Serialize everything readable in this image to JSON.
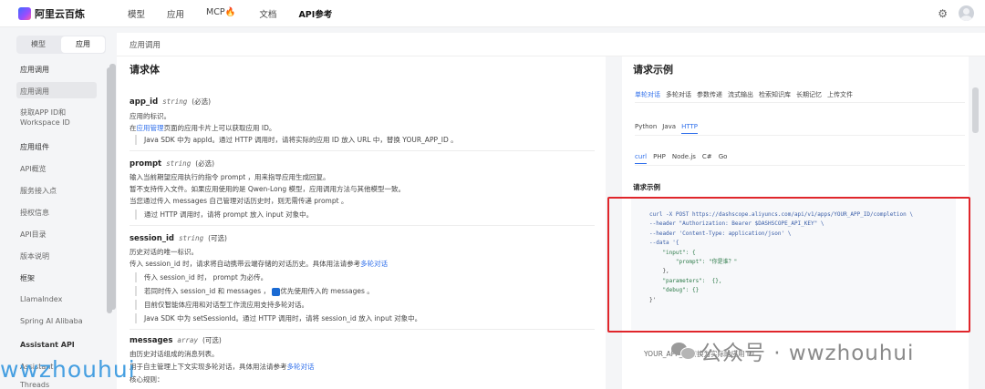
{
  "brand": {
    "name": "阿里云百炼"
  },
  "topnav": {
    "items": [
      "模型",
      "应用",
      "MCP🔥",
      "文档",
      "API参考"
    ]
  },
  "sidebar": {
    "segments": [
      "模型",
      "应用"
    ],
    "section_top": "应用调用",
    "items": [
      "应用调用",
      "获取APP ID和",
      "Workspace ID",
      "应用组件",
      "API概览",
      "服务接入点",
      "授权信息",
      "API目录",
      "版本说明",
      "框架",
      "LlamaIndex",
      "Spring AI Alibaba",
      "Assistant API",
      "Assistant",
      "Threads"
    ]
  },
  "breadcrumb": "应用调用",
  "doc": {
    "title": "请求体",
    "app_id": {
      "name": "app_id",
      "type": "string",
      "req": "(必选)",
      "desc1": "应用的标识。",
      "desc2_pre": "在",
      "desc2_link": "应用管理",
      "desc2_post": "页面的应用卡片上可以获取应用 ID。",
      "note": "Java SDK 中为 appId。通过 HTTP 调用时，请将实际的应用 ID 放入 URL 中，替换 YOUR_APP_ID 。"
    },
    "prompt": {
      "name": "prompt",
      "type": "string",
      "req": "(必选)",
      "desc1": "输入当前期望应用执行的指令 prompt ，用来指导应用生成回复。",
      "desc2": "暂不支持传入文件。如果应用使用的是 Qwen-Long 模型，应用调用方法与其他模型一致。",
      "desc3": "当您通过传入 messages 自己管理对话历史时，则无需传递 prompt 。",
      "note": "通过 HTTP 调用时，请将 prompt 放入 input 对象中。"
    },
    "session_id": {
      "name": "session_id",
      "type": "string",
      "req": "(可选)",
      "desc1": "历史对话的唯一标识。",
      "desc2": "传入 session_id 时，请求将自动携带云端存储的对话历史。具体用法请参考",
      "desc2_link": "多轮对话",
      "note1": "传入 session_id 时， prompt 为必传。",
      "note2_a": "若同时传入 session_id 和 messages ，",
      "note2_b": "优先使用传入的 messages 。",
      "note3": "目前仅智能体应用和对话型工作流应用支持多轮对话。",
      "note4": "Java SDK 中为 setSessionId。通过 HTTP 调用时，请将 session_id 放入 input 对象中。"
    },
    "messages": {
      "name": "messages",
      "type": "array",
      "req": "(可选)",
      "desc1": "由历史对话组成的消息列表。",
      "desc2": "用于自主管理上下文实现多轮对话，具体用法请参考",
      "desc2_link": "多轮对话",
      "desc3": "核心规则："
    }
  },
  "example": {
    "title": "请求示例",
    "tabs1": [
      "单轮对话",
      "多轮对话",
      "参数传递",
      "流式输出",
      "检索知识库",
      "长期记忆",
      "上传文件"
    ],
    "tabs2": [
      "Python",
      "Java",
      "HTTP"
    ],
    "tabs3": [
      "curl",
      "PHP",
      "Node.js",
      "C#",
      "Go"
    ],
    "label": "请求示例",
    "code_lines": [
      "curl -X POST https://dashscope.aliyuncs.com/api/v1/apps/YOUR_APP_ID/completion \\",
      "--header \"Authorization: Bearer $DASHSCOPE_API_KEY\" \\",
      "--header 'Content-Type: application/json' \\",
      "--data '{",
      "    \"input\": {",
      "        \"prompt\": \"你是谁？\"",
      "    },",
      "    \"parameters\":  {},",
      "    \"debug\": {}",
      "}'"
    ],
    "bottom_note": "YOUR_APP_ID替换为实际的应用 ID"
  },
  "watermark": {
    "left": "wwzhouhui",
    "right": "公众号 · wwzhouhui"
  },
  "colors": {
    "accent": "#2f6feb",
    "highlight_box": "#e0262b"
  }
}
